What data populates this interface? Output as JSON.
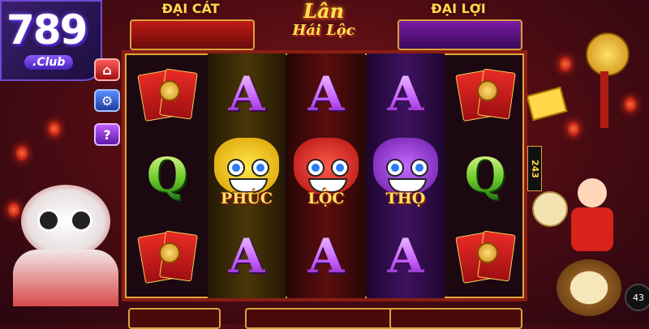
{
  "logo": {
    "number": "789",
    "suffix": ".Club"
  },
  "header": {
    "left_banner": "ĐẠI CÁT",
    "right_banner": "ĐẠI LỢI",
    "title_line1": "Lân",
    "title_line2": "Hái Lộc"
  },
  "side_buttons": [
    {
      "name": "home-icon",
      "glyph": "⌂"
    },
    {
      "name": "settings-gear-icon",
      "glyph": "⚙"
    },
    {
      "name": "help-icon",
      "glyph": "?"
    }
  ],
  "reels": [
    {
      "symbols": [
        "red-envelope",
        "Q",
        "red-envelope"
      ]
    },
    {
      "symbols": [
        "A",
        "lion-yellow",
        "A"
      ]
    },
    {
      "symbols": [
        "A",
        "lion-red",
        "A"
      ]
    },
    {
      "symbols": [
        "A",
        "lion-purple",
        "A"
      ]
    },
    {
      "symbols": [
        "red-envelope",
        "Q",
        "red-envelope"
      ]
    }
  ],
  "lion_labels": {
    "yellow": "PHÚC",
    "red": "LỘC",
    "purple": "THỌ"
  },
  "ways": "243",
  "counter": "43",
  "colors": {
    "frame": "#8a1d12",
    "gold": "#ffd84a",
    "purple_reel": "#3a1250",
    "gold_reel": "#3a2a08",
    "red_reel": "#3a0a0a"
  }
}
